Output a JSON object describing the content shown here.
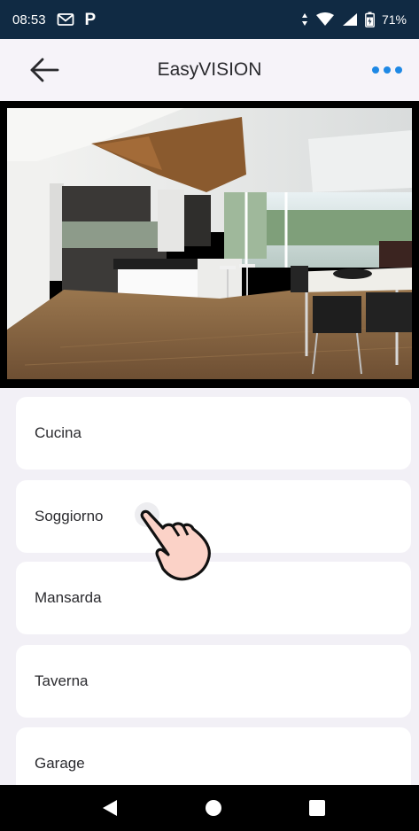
{
  "status_bar": {
    "time": "08:53",
    "battery_percent": "71%",
    "icons": [
      "gmail-icon",
      "parking-icon",
      "data-arrows-icon",
      "wifi-icon",
      "signal-icon",
      "battery-icon"
    ],
    "parking_letter": "P"
  },
  "app_bar": {
    "title": "EasyVISION",
    "back_icon": "arrow-left-icon",
    "more_icon": "more-dots-icon",
    "accent_color": "#1e88e5"
  },
  "rooms": [
    {
      "label": "Cucina"
    },
    {
      "label": "Soggiorno"
    },
    {
      "label": "Mansarda"
    },
    {
      "label": "Taverna"
    },
    {
      "label": "Garage"
    }
  ],
  "nav_bar": {
    "icons": [
      "back-triangle-icon",
      "home-circle-icon",
      "recents-square-icon"
    ]
  }
}
